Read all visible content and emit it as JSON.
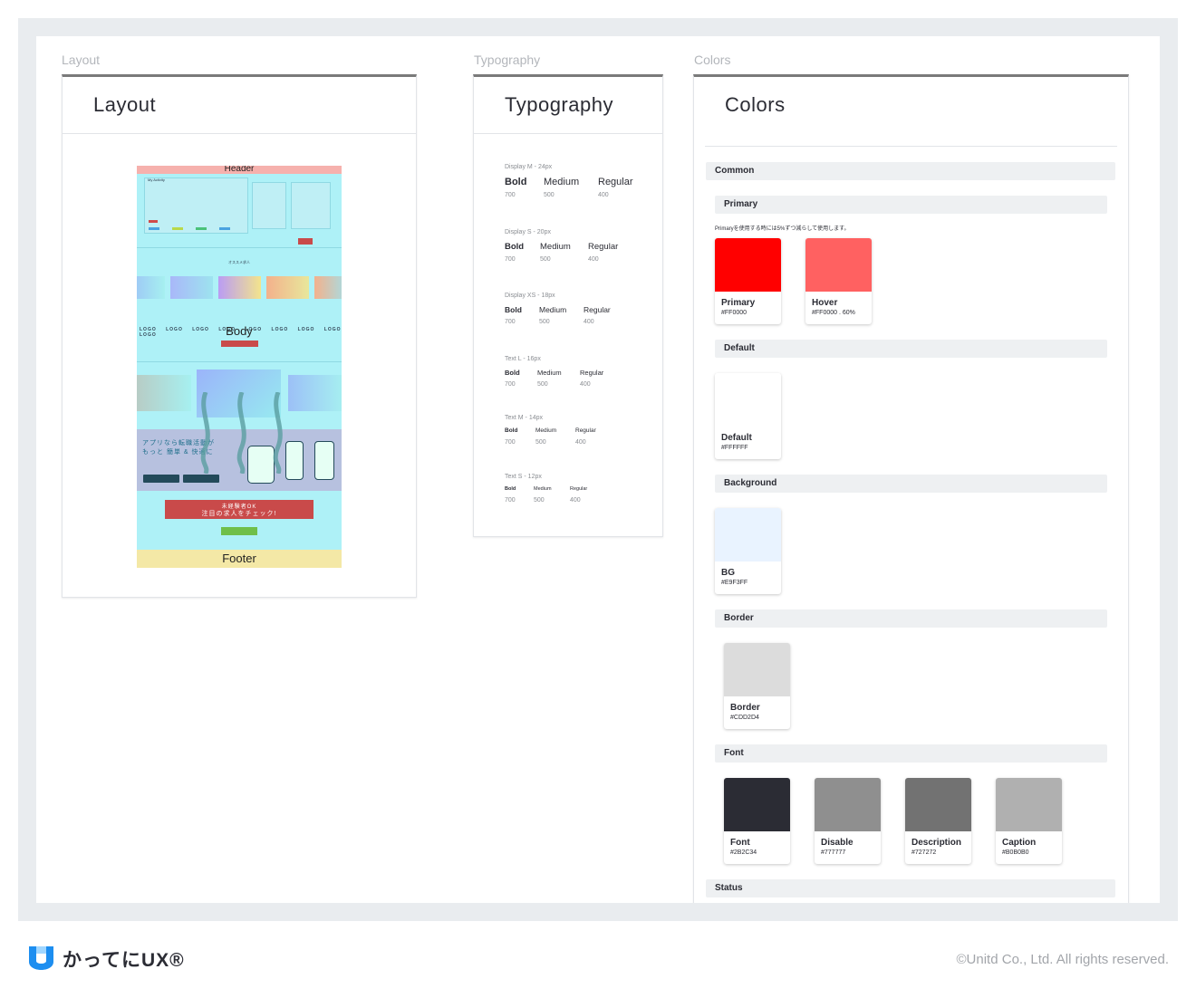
{
  "sections": {
    "layout": {
      "label": "Layout",
      "title": "Layout"
    },
    "typography": {
      "label": "Typography",
      "title": "Typography"
    },
    "colors": {
      "label": "Colors",
      "title": "Colors"
    }
  },
  "mockup": {
    "header": "Header",
    "body": "Body",
    "footer": "Footer",
    "activity_title": "My Activity",
    "recommend": "オススメ求人",
    "app_promo_line1": "アプリなら転職活動が",
    "app_promo_line2": "もっと 簡単 & 快適に",
    "cta_line1": "未経験者OK",
    "cta_line2": "注目の求人をチェック!",
    "logo": "LOGO",
    "sample": "Sample",
    "app_download": "App Download"
  },
  "typography": {
    "groups": [
      {
        "label": "Display M - 24px",
        "bold": "Bold",
        "medium": "Medium",
        "regular": "Regular",
        "w_bold": "700",
        "w_medium": "500",
        "w_regular": "400"
      },
      {
        "label": "Display S - 20px",
        "bold": "Bold",
        "medium": "Medium",
        "regular": "Regular",
        "w_bold": "700",
        "w_medium": "500",
        "w_regular": "400"
      },
      {
        "label": "Display XS - 18px",
        "bold": "Bold",
        "medium": "Medium",
        "regular": "Regular",
        "w_bold": "700",
        "w_medium": "500",
        "w_regular": "400"
      },
      {
        "label": "Text L - 16px",
        "bold": "Bold",
        "medium": "Medium",
        "regular": "Regular",
        "w_bold": "700",
        "w_medium": "500",
        "w_regular": "400"
      },
      {
        "label": "Text M - 14px",
        "bold": "Bold",
        "medium": "Medium",
        "regular": "Regular",
        "w_bold": "700",
        "w_medium": "500",
        "w_regular": "400"
      },
      {
        "label": "Text S - 12px",
        "bold": "Bold",
        "medium": "Medium",
        "regular": "Regular",
        "w_bold": "700",
        "w_medium": "500",
        "w_regular": "400"
      }
    ]
  },
  "colors": {
    "common": "Common",
    "primary": {
      "label": "Primary",
      "note": "Primaryを使用する時には5%ずつ減らして使用します。",
      "swatches": [
        {
          "name": "Primary",
          "hex": "#FF0000",
          "color": "#ff0000"
        },
        {
          "name": "Hover",
          "hex": "#FF0000 . 60%",
          "color": "#ff6161"
        }
      ]
    },
    "default": {
      "label": "Default",
      "swatches": [
        {
          "name": "Default",
          "hex": "#FFFFFF",
          "color": "#ffffff"
        }
      ]
    },
    "background": {
      "label": "Background",
      "swatches": [
        {
          "name": "BG",
          "hex": "#E9F3FF",
          "color": "#e9f3ff"
        }
      ]
    },
    "border": {
      "label": "Border",
      "swatches": [
        {
          "name": "Border",
          "hex": "#CDD2D4",
          "color": "#dcdcdc"
        }
      ]
    },
    "font": {
      "label": "Font",
      "swatches": [
        {
          "name": "Font",
          "hex": "#2B2C34",
          "color": "#2b2c34"
        },
        {
          "name": "Disable",
          "hex": "#777777",
          "color": "#8f8f8f"
        },
        {
          "name": "Description",
          "hex": "#727272",
          "color": "#727272"
        },
        {
          "name": "Caption",
          "hex": "#B0B0B0",
          "color": "#b0b0b0"
        }
      ]
    },
    "status": "Status"
  },
  "footer": {
    "brand": "かってにUX®",
    "copyright": "©Unitd Co., Ltd. All rights reserved."
  }
}
